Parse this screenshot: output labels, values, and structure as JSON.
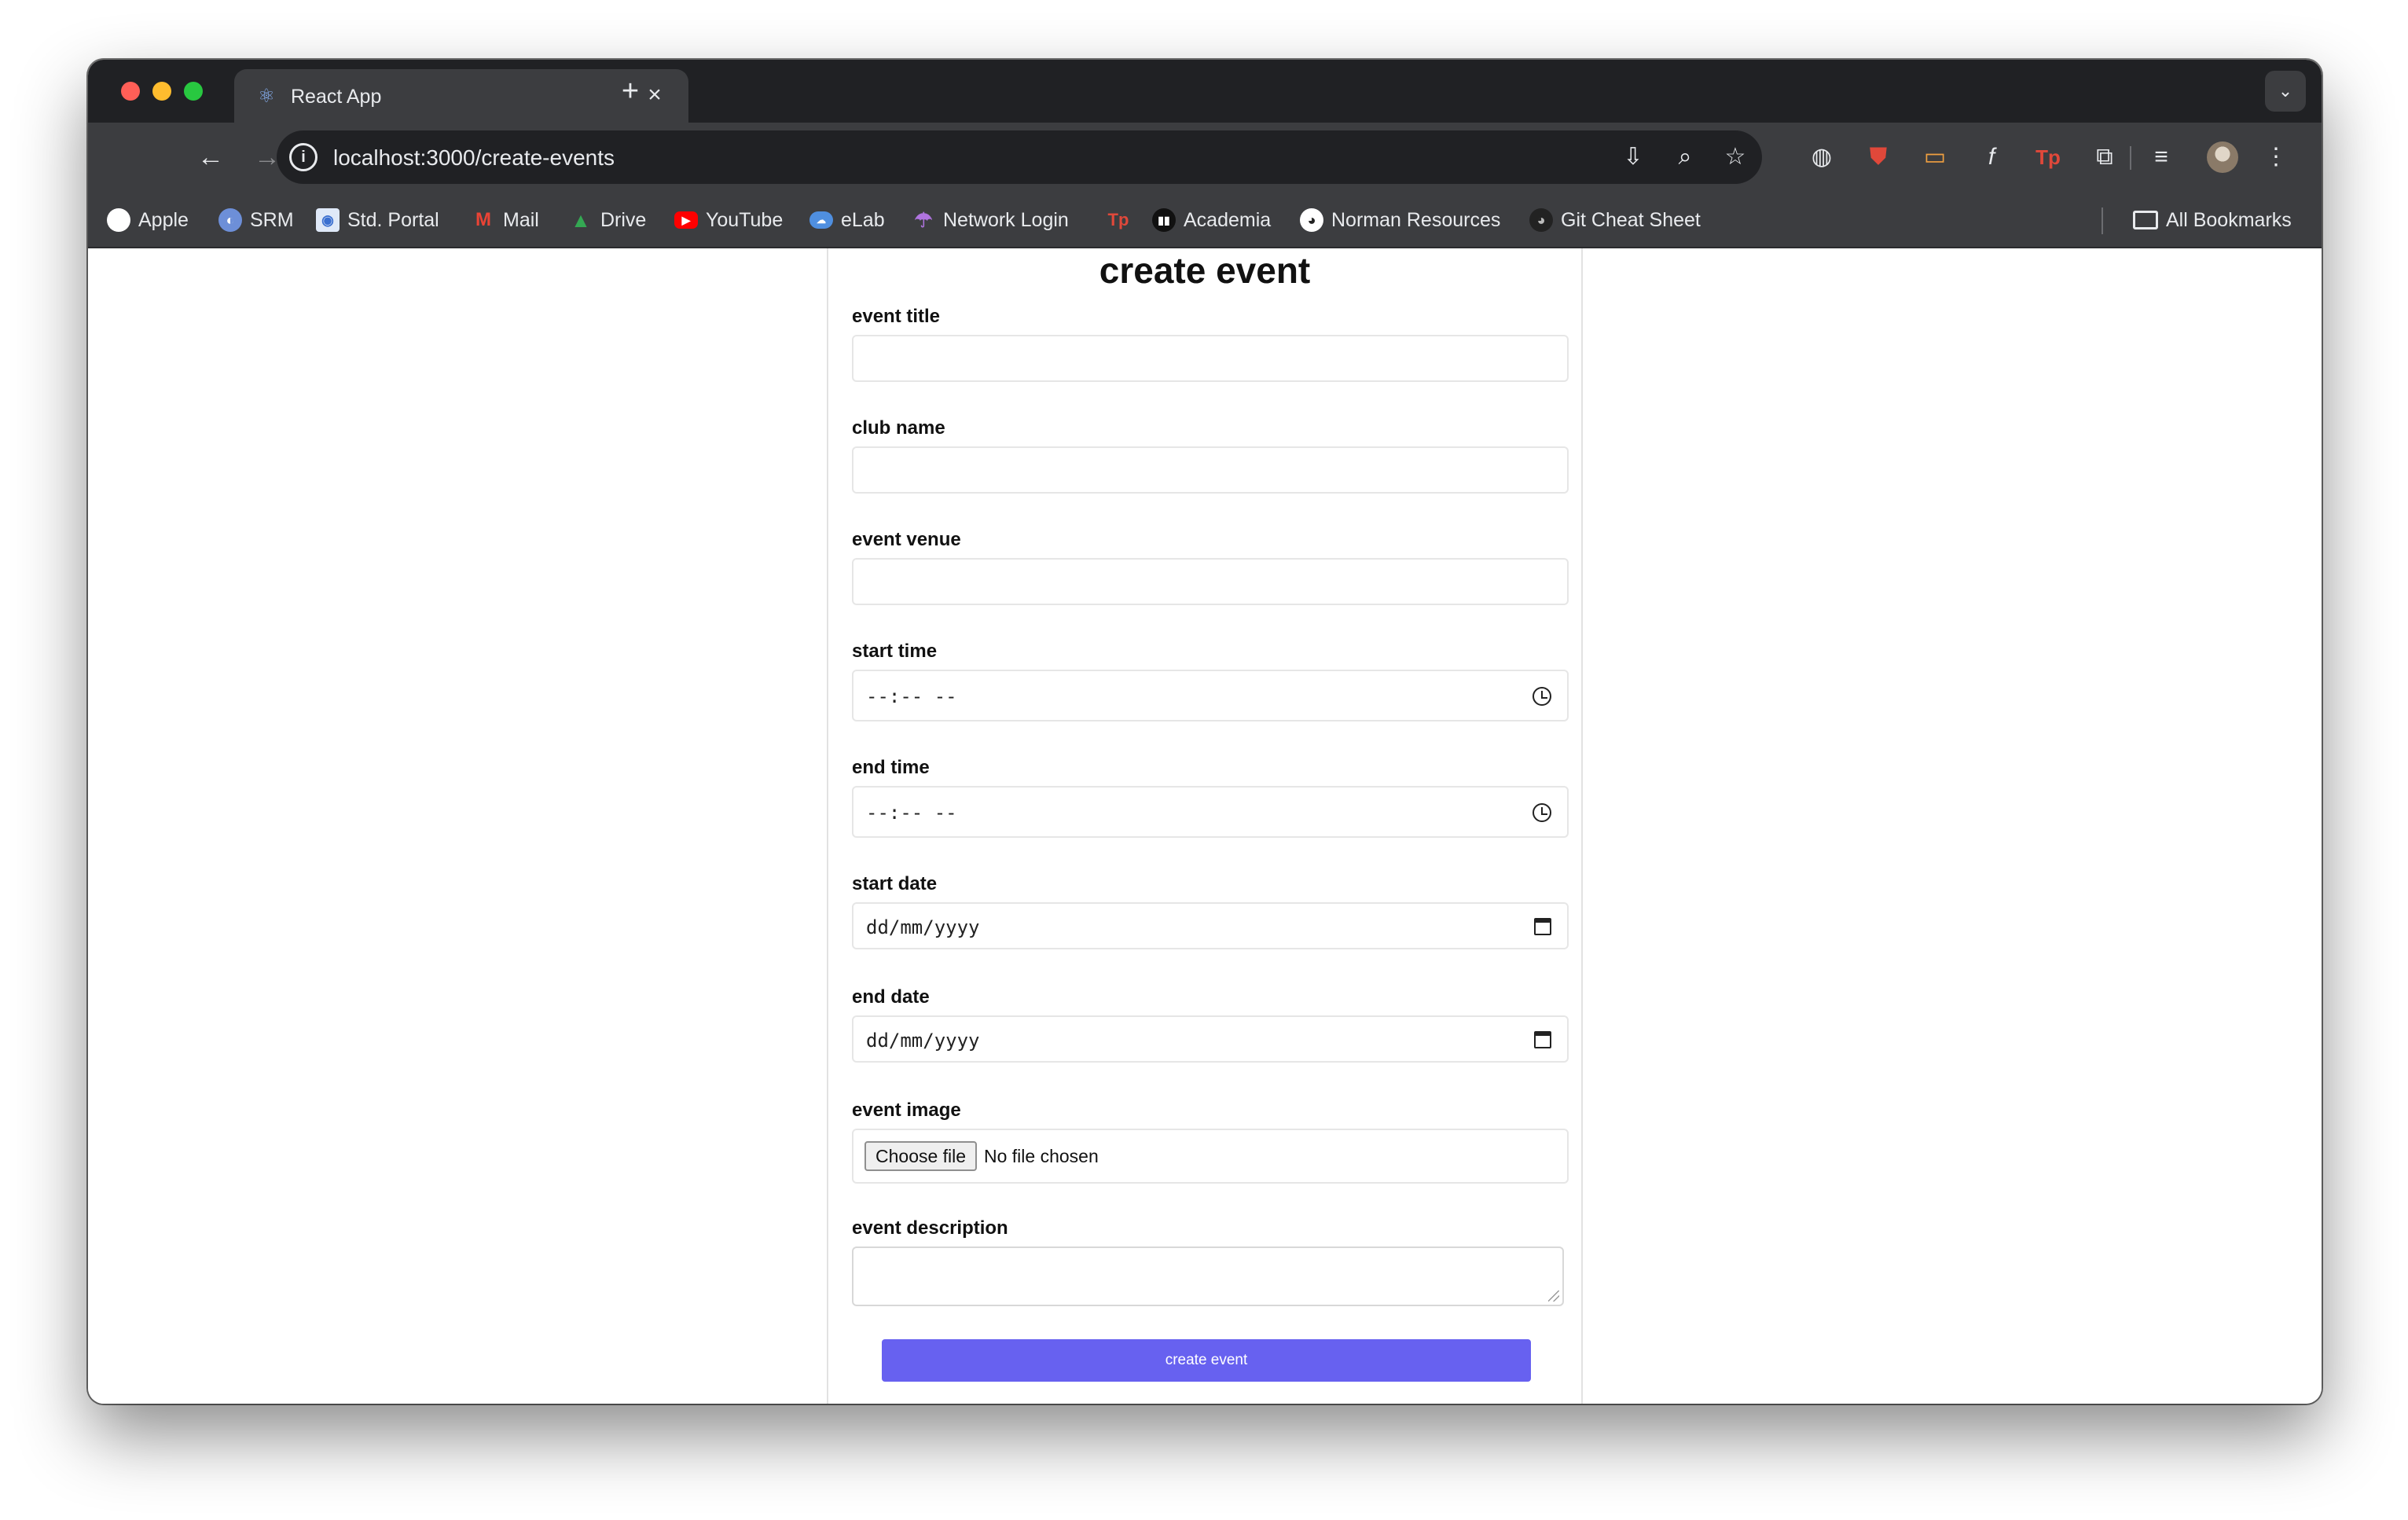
{
  "browser": {
    "tab_title": "React App",
    "tab_icon": "react-icon",
    "url": "localhost:3000/create-events"
  },
  "bookmarks": [
    {
      "label": "Apple",
      "icon": "apple-icon",
      "color": "#ffffff"
    },
    {
      "label": "SRM",
      "icon": "srm-icon",
      "color": "#6d8fd8"
    },
    {
      "label": "Std. Portal",
      "icon": "portal-icon",
      "color": "#6aa0e8"
    },
    {
      "label": "Mail",
      "icon": "gmail-icon",
      "color": "#ea4335"
    },
    {
      "label": "Drive",
      "icon": "drive-icon",
      "color": "#34a853"
    },
    {
      "label": "YouTube",
      "icon": "youtube-icon",
      "color": "#ff0000"
    },
    {
      "label": "eLab",
      "icon": "elab-icon",
      "color": "#4f8fe0"
    },
    {
      "label": "Network Login",
      "icon": "umbrella-icon",
      "color": "#b074e0"
    },
    {
      "label": "",
      "icon": "tp-icon",
      "color": "#e0483a"
    },
    {
      "label": "Academia",
      "icon": "academia-icon",
      "color": "#111111"
    },
    {
      "label": "Norman Resources",
      "icon": "github-icon",
      "color": "#ffffff"
    },
    {
      "label": "Git Cheat Sheet",
      "icon": "github-icon",
      "color": "#222222"
    }
  ],
  "all_bookmarks_label": "All Bookmarks",
  "form": {
    "title": "create event",
    "event_title_label": "event title",
    "club_name_label": "club name",
    "event_venue_label": "event venue",
    "start_time_label": "start time",
    "start_time_value": "--:-- --",
    "end_time_label": "end time",
    "end_time_value": "--:-- --",
    "start_date_label": "start date",
    "start_date_value": "dd/mm/yyyy",
    "end_date_label": "end date",
    "end_date_value": "dd/mm/yyyy",
    "event_image_label": "event image",
    "choose_file_label": "Choose file",
    "file_status": "No file chosen",
    "event_description_label": "event description",
    "submit_label": "create event"
  },
  "colors": {
    "submit_button": "#6761f0",
    "tab_bar": "#202124",
    "toolbar": "#3c3d40"
  }
}
